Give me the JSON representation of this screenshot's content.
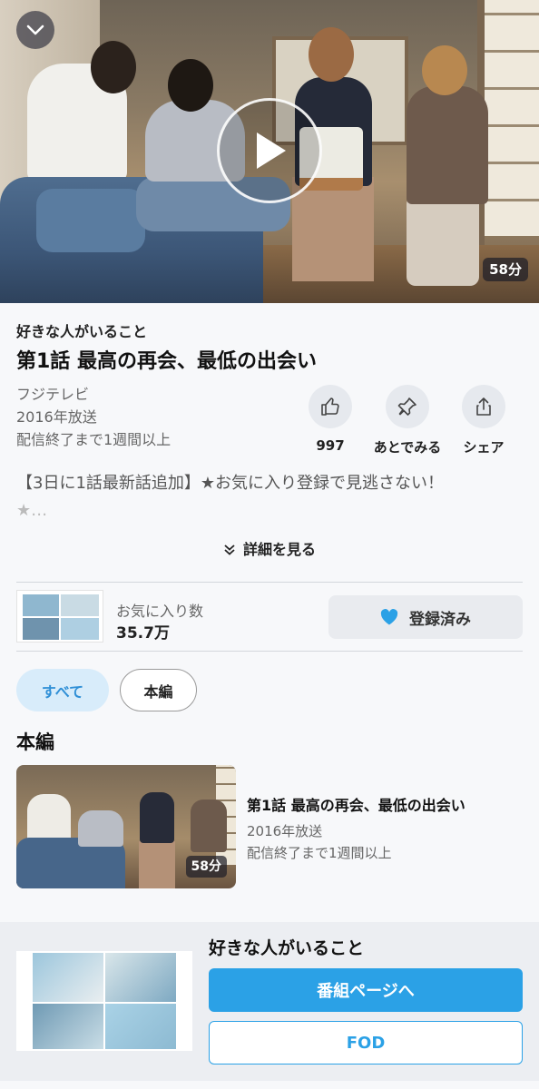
{
  "player": {
    "duration_badge": "58分",
    "collapse_icon": "chevron-down-icon",
    "play_icon": "play-icon"
  },
  "episode": {
    "series_title": "好きな人がいること",
    "title": "第1話 最高の再会、最低の出会い",
    "broadcaster": "フジテレビ",
    "year": "2016年放送",
    "availability": "配信終了まで1週間以上"
  },
  "actions": [
    {
      "label": "997",
      "icon": "thumbs-up-icon"
    },
    {
      "label": "あとでみる",
      "icon": "pin-icon"
    },
    {
      "label": "シェア",
      "icon": "share-icon"
    }
  ],
  "description": {
    "text": "【3日に1話最新話追加】★お気に入り登録で見逃さない！",
    "text_fade": "★…"
  },
  "more_link": "詳細を見る",
  "favorites": {
    "label": "お気に入り数",
    "count": "35.7万",
    "button_label": "登録済み"
  },
  "filters": [
    {
      "label": "すべて",
      "active": true
    },
    {
      "label": "本編",
      "active": false
    }
  ],
  "section_heading": "本編",
  "episode_list": [
    {
      "title": "第1話 最高の再会、最低の出会い",
      "year": "2016年放送",
      "availability": "配信終了まで1週間以上",
      "duration": "58分"
    }
  ],
  "promo": {
    "title": "好きな人がいること",
    "primary_button": "番組ページへ",
    "secondary_button": "FOD"
  },
  "colors": {
    "accent_blue": "#2ba1e6",
    "chip_active_bg": "#d8ecfa",
    "chip_active_text": "#2f8fd6"
  }
}
